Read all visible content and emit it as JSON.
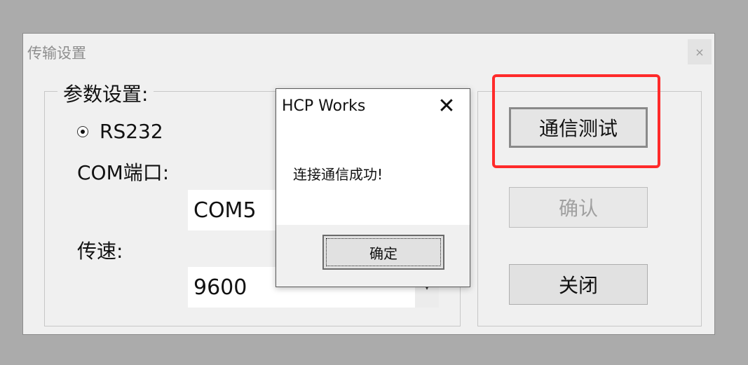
{
  "window": {
    "title": "传输设置",
    "close_glyph": "×"
  },
  "params": {
    "group_label": "参数设置:",
    "radio_label": "RS232",
    "com_label": "COM端口:",
    "com_value": "COM5",
    "baud_label": "传速:",
    "baud_value": "9600",
    "dropdown_arrow": "▾"
  },
  "buttons": {
    "test": "通信测试",
    "confirm": "确认",
    "close": "关闭"
  },
  "message_box": {
    "title": "HCP Works",
    "close_glyph": "✕",
    "text": "连接通信成功!",
    "ok": "确定"
  },
  "colors": {
    "highlight": "#ff2a2a"
  }
}
